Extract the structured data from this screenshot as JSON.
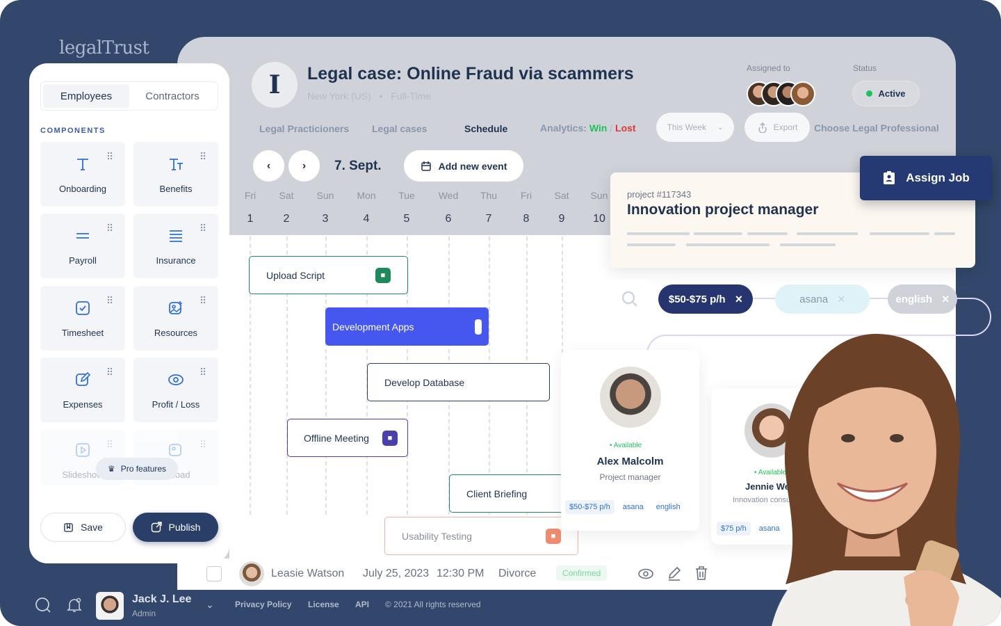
{
  "brand": "legalTrust",
  "case": {
    "logo_letter": "I",
    "title": "Legal case: Online Fraud via scammers",
    "location": "New York (US)",
    "type": "Full-Time",
    "separator": "•"
  },
  "assigned_label": "Assigned to",
  "status_label": "Status",
  "status_value": "Active",
  "tabs": [
    {
      "label": "Legal Practicioners"
    },
    {
      "label": "Legal cases"
    },
    {
      "label": "Schedule"
    }
  ],
  "analytics": {
    "prefix": "Analytics:",
    "win": "Win",
    "slash": "/",
    "lost": "Lost"
  },
  "week_select": "This Week",
  "export_label": "Export",
  "choose_label": "Choose Legal Professional",
  "calendar": {
    "current_date": "7. Sept.",
    "add_event": "Add new event",
    "days": [
      {
        "name": "Fri",
        "num": "1"
      },
      {
        "name": "Sat",
        "num": "2"
      },
      {
        "name": "Sun",
        "num": "3"
      },
      {
        "name": "Mon",
        "num": "4"
      },
      {
        "name": "Tue",
        "num": "5"
      },
      {
        "name": "Wed",
        "num": "6"
      },
      {
        "name": "Thu",
        "num": "7"
      },
      {
        "name": "Fri",
        "num": "8"
      },
      {
        "name": "Sat",
        "num": "9"
      },
      {
        "name": "Sun",
        "num": "10"
      }
    ],
    "tasks": [
      {
        "label": "Upload Script"
      },
      {
        "label": "Development Apps"
      },
      {
        "label": "Develop Database"
      },
      {
        "label": "Offline Meeting"
      },
      {
        "label": "Client Briefing"
      },
      {
        "label": "Usability Testing"
      }
    ]
  },
  "sidebar": {
    "segments": [
      "Employees",
      "Contractors"
    ],
    "components_heading": "COMPONENTS",
    "components": [
      {
        "label": "Onboarding",
        "icon": "text-icon"
      },
      {
        "label": "Benefits",
        "icon": "text-size-icon"
      },
      {
        "label": "Payroll",
        "icon": "equals-icon"
      },
      {
        "label": "Insurance",
        "icon": "lines-icon"
      },
      {
        "label": "Timesheet",
        "icon": "check-square-icon"
      },
      {
        "label": "Resources",
        "icon": "image-add-icon"
      },
      {
        "label": "Expenses",
        "icon": "edit-icon"
      },
      {
        "label": "Profit / Loss",
        "icon": "eye-icon"
      },
      {
        "label": "Slideshow",
        "icon": "play-icon"
      },
      {
        "label": "Upload",
        "icon": "image-add-icon"
      }
    ],
    "pro_features": "Pro features",
    "save": "Save",
    "publish": "Publish"
  },
  "project": {
    "id": "project #117343",
    "title": "Innovation project manager",
    "assign_job": "Assign Job"
  },
  "filters": [
    {
      "label": "$50-$75 p/h"
    },
    {
      "label": "asana"
    },
    {
      "label": "english"
    }
  ],
  "profiles": [
    {
      "availability": "• Available",
      "name": "Alex Malcolm",
      "role": "Project manager",
      "tags": [
        "$50-$75 p/h",
        "asana",
        "english"
      ]
    },
    {
      "availability": "• Available",
      "name": "Jennie West",
      "role": "Innovation consul",
      "tags": [
        "$75 p/h",
        "asana"
      ]
    }
  ],
  "appointment": {
    "name": "Leasie Watson",
    "date": "July 25, 2023",
    "time": "12:30 PM",
    "category": "Divorce",
    "status": "Confirmed"
  },
  "user": {
    "name": "Jack J. Lee",
    "role": "Admin"
  },
  "footer": {
    "links": [
      "Privacy Policy",
      "License",
      "API"
    ],
    "copyright": "© 2021 All rights reserved"
  },
  "colors": {
    "navy": "#32476b",
    "primary_dark": "#1f3250",
    "accent_blue": "#4657f0",
    "green": "#20c15a",
    "red": "#e0383e",
    "task_green": "#1e8a5a",
    "task_purple": "#4b3fa8",
    "task_orange": "#f08c6e"
  }
}
